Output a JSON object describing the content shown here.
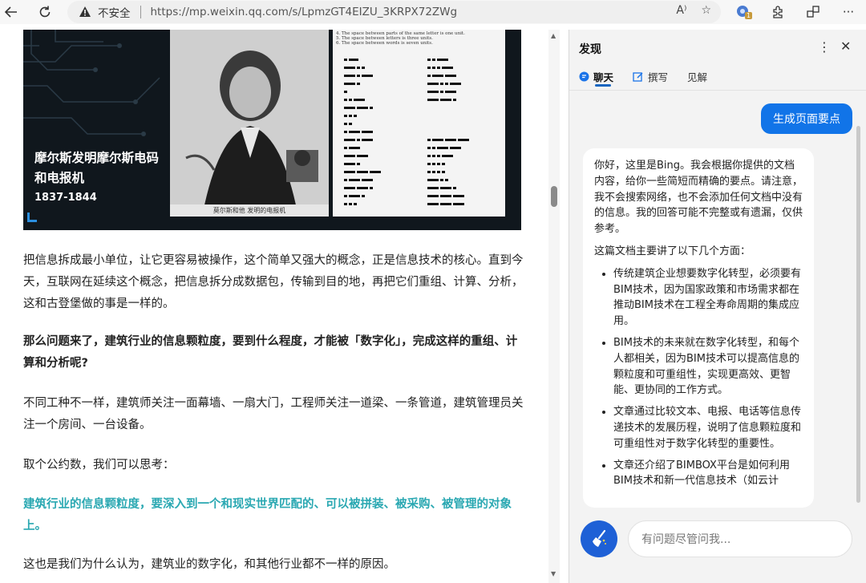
{
  "browser": {
    "security_label": "不安全",
    "url": "https://mp.weixin.qq.com/s/LpmzGT4EIZU_3KRPX72ZWg",
    "read_aloud_label": "A⁾",
    "badge_count": "1"
  },
  "article": {
    "hero": {
      "title": "摩尔斯发明摩尔斯电码和电报机",
      "years": "1837-1844",
      "portrait_caption": "莫尔斯和他 发明的电报机",
      "morse_rules": [
        "4. The space between parts of the same letter is one unit.",
        "5. The space between letters is three units.",
        "6. The space between words is seven units."
      ]
    },
    "p1": "把信息拆成最小单位，让它更容易被操作，这个简单又强大的概念，正是信息技术的核心。直到今天，互联网在延续这个概念，把信息拆分成数据包，传输到目的地，再把它们重组、计算、分析，这和古登堡做的事是一样的。",
    "p2": "那么问题来了，建筑行业的信息颗粒度，要到什么程度，才能被「数字化」，完成这样的重组、计算和分析呢?",
    "p3": "不同工种不一样，建筑师关注一面幕墙、一扇大门，工程师关注一道梁、一条管道，建筑管理员关注一个房间、一台设备。",
    "p4": "取个公约数，我们可以思考：",
    "p5": "建筑行业的信息颗粒度，要深入到一个和现实世界匹配的、可以被拼装、被采购、被管理的对象上。",
    "p6": "这也是我们为什么认为，建筑业的数字化，和其他行业都不一样的原因。"
  },
  "sidebar": {
    "title": "发现",
    "tabs": [
      {
        "label": "聊天",
        "icon": "chat-icon"
      },
      {
        "label": "撰写",
        "icon": "compose-icon"
      },
      {
        "label": "见解",
        "icon": "insights-icon"
      }
    ],
    "generate_button": "生成页面要点",
    "chat": {
      "intro": "你好，这里是Bing。我会根据你提供的文档内容，给你一些简短而精确的要点。请注意，我不会搜索网络，也不会添加任何文档中没有的信息。我的回答可能不完整或有遗漏，仅供参考。",
      "summary_lead": "这篇文档主要讲了以下几个方面：",
      "bullets": [
        "传统建筑企业想要数字化转型，必须要有BIM技术，因为国家政策和市场需求都在推动BIM技术在工程全寿命周期的集成应用。",
        "BIM技术的未来就在数字化转型，和每个人都相关，因为BIM技术可以提高信息的颗粒度和可重组性，实现更高效、更智能、更协同的工作方式。",
        "文章通过比较文本、电报、电话等信息传递技术的发展历程，说明了信息颗粒度和可重组性对于数字化转型的重要性。",
        "文章还介绍了BIMBOX平台是如何利用BIM技术和新一代信息技术（如云计"
      ]
    },
    "input_placeholder": "有问题尽管问我..."
  }
}
